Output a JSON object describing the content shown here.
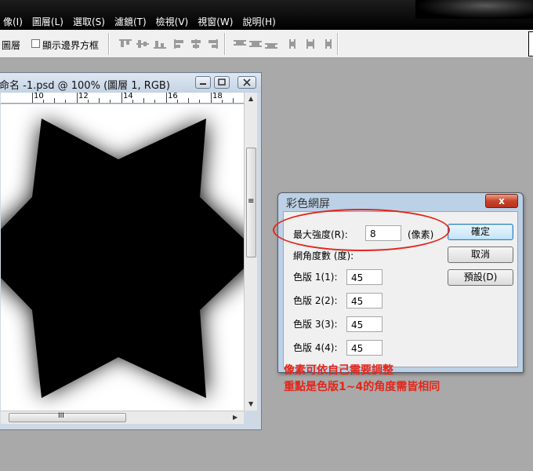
{
  "menu": [
    "像(I)",
    "圖層(L)",
    "選取(S)",
    "濾鏡(T)",
    "檢視(V)",
    "視窗(W)",
    "說明(H)"
  ],
  "options_bar": {
    "layer_label": "圖層",
    "show_bounds_label": "顯示邊界方框"
  },
  "document": {
    "title": "命名 -1.psd @ 100% (圖層 1, RGB)",
    "ruler_numbers": [
      "10",
      "12",
      "14",
      "16",
      "18"
    ],
    "hscroll_grip": "III",
    "vscroll_grip": "≡"
  },
  "dialog": {
    "title": "彩色網屏",
    "close_glyph": "x",
    "max_radius_label": "最大強度(R):",
    "max_radius_value": "8",
    "unit_label": "(像素)",
    "angles_label": "網角度數 (度):",
    "channels": [
      {
        "label": "色版 1(1):",
        "value": "45"
      },
      {
        "label": "色版 2(2):",
        "value": "45"
      },
      {
        "label": "色版 3(3):",
        "value": "45"
      },
      {
        "label": "色版 4(4):",
        "value": "45"
      }
    ],
    "ok_label": "確定",
    "cancel_label": "取消",
    "default_label": "預設(D)"
  },
  "annotation": {
    "line1": "像素可依自己需要調整",
    "line2": "重點是色版1~4的角度需皆相同",
    "color": "#e3261a"
  }
}
